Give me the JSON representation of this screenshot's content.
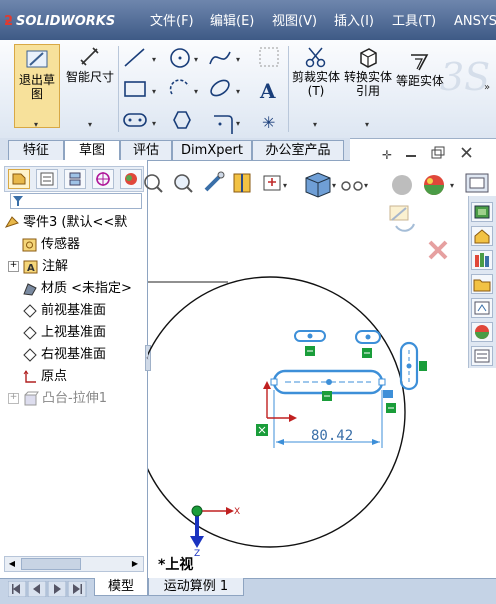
{
  "app": {
    "logo_brand": "SOLIDWORKS"
  },
  "menu": [
    "文件(F)",
    "编辑(E)",
    "视图(V)",
    "插入(I)",
    "工具(T)",
    "ANSYS"
  ],
  "toolbar": {
    "exit_sketch": "退出草图",
    "smart_dimension": "智能尺寸",
    "trim": "剪裁实体(T)",
    "convert": "转换实体引用",
    "offset": "等距实体"
  },
  "tabs": [
    "特征",
    "草图",
    "评估",
    "DimXpert",
    "办公室产品"
  ],
  "active_tab": "草图",
  "tree": [
    {
      "label": "零件3 (默认<<默",
      "icon": "part-icon",
      "expand": false
    },
    {
      "label": "传感器",
      "icon": "sensor-icon",
      "expand": false
    },
    {
      "label": "注解",
      "icon": "annotation-icon",
      "expand": true
    },
    {
      "label": "材质 <未指定>",
      "icon": "material-icon",
      "expand": false
    },
    {
      "label": "前视基准面",
      "icon": "plane-icon",
      "expand": false
    },
    {
      "label": "上视基准面",
      "icon": "plane-icon",
      "expand": false
    },
    {
      "label": "右视基准面",
      "icon": "plane-icon",
      "expand": false
    },
    {
      "label": "原点",
      "icon": "origin-icon",
      "expand": false
    },
    {
      "label": "凸台-拉伸1",
      "icon": "extrude-icon",
      "expand": true,
      "disabled": true
    }
  ],
  "graphics": {
    "view_label": "*上视",
    "dimension_value": "80.42"
  },
  "bottom_tabs": [
    "模型",
    "运动算例 1"
  ],
  "active_bottom_tab": "模型"
}
